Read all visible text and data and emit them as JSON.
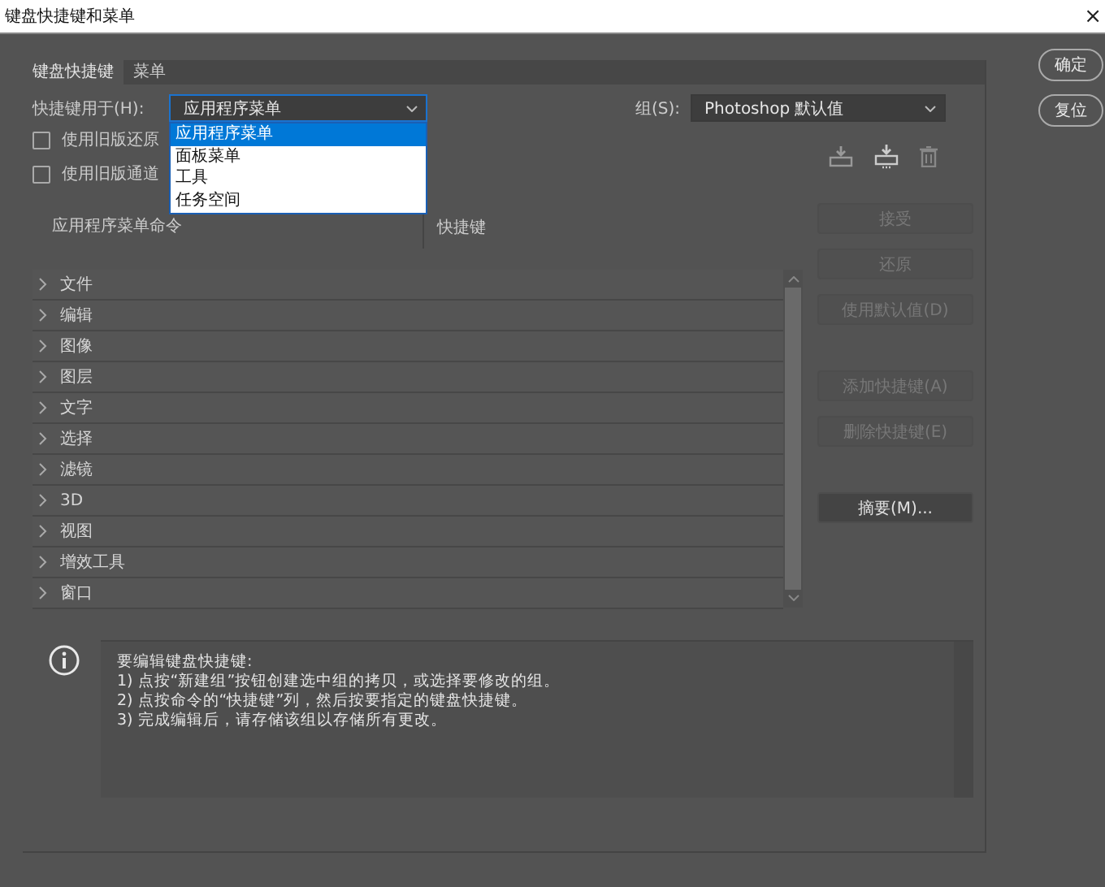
{
  "window": {
    "title": "键盘快捷键和菜单",
    "close": "×"
  },
  "dialog_buttons": [
    {
      "label": "确定"
    },
    {
      "label": "复位"
    }
  ],
  "tabs": [
    {
      "label": "键盘快捷键",
      "selected": true
    },
    {
      "label": "菜单",
      "selected": false
    }
  ],
  "shortcuts_for": {
    "label": "快捷键用于(H):",
    "value": "应用程序菜单",
    "expanded": true,
    "options": [
      {
        "label": "应用程序菜单",
        "selected": true
      },
      {
        "label": "面板菜单",
        "selected": false
      },
      {
        "label": "工具",
        "selected": false
      },
      {
        "label": "任务空间",
        "selected": false
      }
    ]
  },
  "set": {
    "label": "组(S):",
    "value": "Photoshop 默认值"
  },
  "checkboxes": [
    {
      "label": "使用旧版还原",
      "checked": false
    },
    {
      "label": "使用旧版通道",
      "checked": false
    }
  ],
  "table": {
    "columns": [
      "应用程序菜单命令",
      "快捷键"
    ],
    "rows": [
      {
        "label": "文件",
        "expanded": false
      },
      {
        "label": "编辑",
        "expanded": false
      },
      {
        "label": "图像",
        "expanded": false
      },
      {
        "label": "图层",
        "expanded": false
      },
      {
        "label": "文字",
        "expanded": false
      },
      {
        "label": "选择",
        "expanded": false
      },
      {
        "label": "滤镜",
        "expanded": false
      },
      {
        "label": "3D",
        "expanded": false
      },
      {
        "label": "视图",
        "expanded": false
      },
      {
        "label": "增效工具",
        "expanded": false
      },
      {
        "label": "窗口",
        "expanded": false
      }
    ]
  },
  "action_groups": [
    [
      {
        "label": "接受",
        "disabled": true
      },
      {
        "label": "还原",
        "disabled": true
      },
      {
        "label": "使用默认值(D)",
        "disabled": true
      }
    ],
    [
      {
        "label": "添加快捷键(A)",
        "disabled": true
      },
      {
        "label": "删除快捷键(E)",
        "disabled": true
      }
    ],
    [
      {
        "label": "摘要(M)...",
        "disabled": false
      }
    ]
  ],
  "info_lines": [
    "要编辑键盘快捷键:",
    "1) 点按“新建组”按钮创建选中组的拷贝，或选择要修改的组。",
    "2) 点按命令的“快捷键”列，然后按要指定的键盘快捷键。",
    "3) 完成编辑后，请存储该组以存储所有更改。"
  ]
}
